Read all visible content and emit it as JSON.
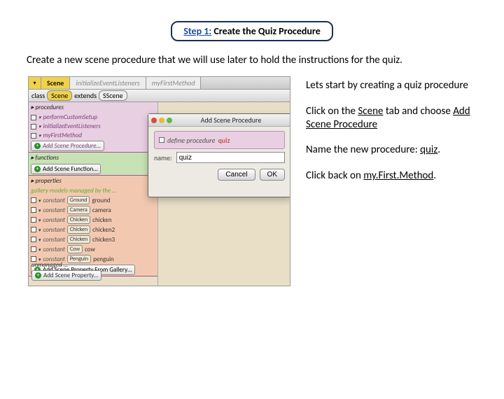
{
  "title": {
    "step": "Step 1:",
    "rest": " Create the Quiz Procedure"
  },
  "intro": "Create a new scene procedure that we will use later to hold the instructions for the quiz.",
  "shot": {
    "tabs": {
      "t1": "Scene",
      "t2": "initializeEventListeners",
      "t3": "myFirstMethod"
    },
    "classbar": {
      "w1": "class",
      "w2": "Scene",
      "w3": "extends",
      "w4": "SScene"
    },
    "procedures": {
      "hdr": "▸ procedures",
      "r1": "performCustomSetup",
      "r2": "initializeEventListeners",
      "r3": "myFirstMethod",
      "add": "Add Scene Procedure…"
    },
    "functions": {
      "hdr": "▸ functions",
      "add": "Add Scene Function…"
    },
    "properties": {
      "hdr": "▸ properties",
      "note": "gallery models managed by the …",
      "rows": [
        {
          "kw": "constant",
          "type": "Ground",
          "name": "ground"
        },
        {
          "kw": "constant",
          "type": "Camera",
          "name": "camera"
        },
        {
          "kw": "constant",
          "type": "Chicken",
          "name": "chicken"
        },
        {
          "kw": "constant",
          "type": "Chicken",
          "name": "chicken2"
        },
        {
          "kw": "constant",
          "type": "Chicken",
          "name": "chicken3"
        },
        {
          "kw": "constant",
          "type": "Cow",
          "name": "cow"
        },
        {
          "kw": "constant",
          "type": "Penguin",
          "name": "penguin"
        }
      ],
      "addGallery": "Add Scene Property From Gallery…"
    },
    "unmanaged": {
      "hdr": "unmanaged …",
      "add": "Add Scene Property…"
    },
    "dialog": {
      "title": "Add Scene Procedure",
      "previewKw": "define procedure",
      "previewName": "quiz",
      "nameLabel": "name:",
      "nameValue": "quiz",
      "cancel": "Cancel",
      "ok": "OK"
    }
  },
  "instr": {
    "p1": "Lets start by creating a quiz procedure",
    "p2a": "Click on the ",
    "p2scene": "Scene",
    "p2b": " tab and choose ",
    "p2add": "Add Scene Procedure",
    "p3a": "Name the new procedure: ",
    "p3quiz": "quiz",
    "p3b": ".",
    "p4a": "Click back on ",
    "p4m": "my.First.Method",
    "p4b": "."
  }
}
